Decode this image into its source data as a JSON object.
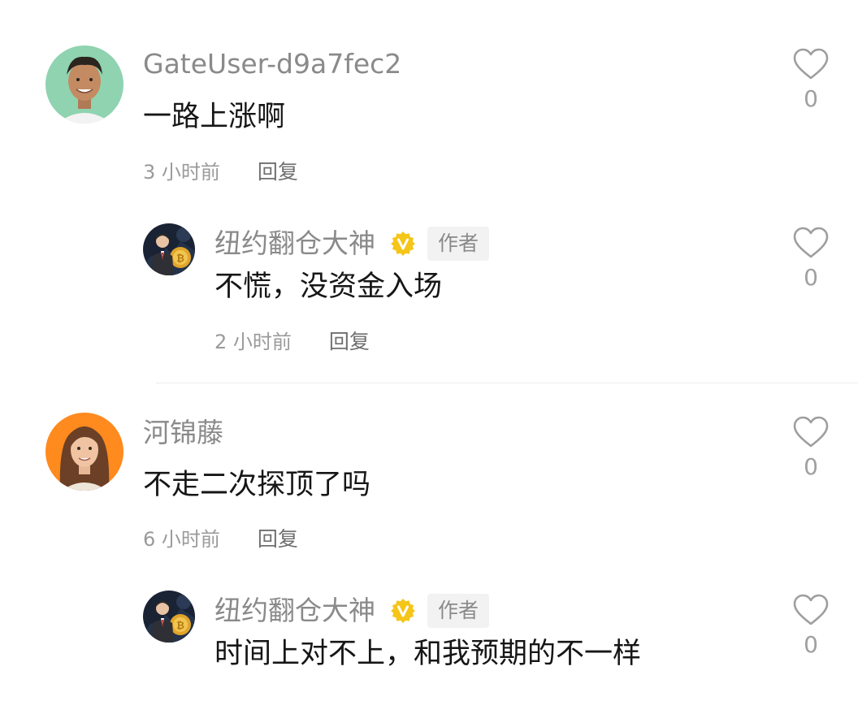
{
  "comments": [
    {
      "username": "GateUser-d9a7fec2",
      "text": "一路上涨啊",
      "time": "3 小时前",
      "reply_label": "回复",
      "likes": "0",
      "avatar_icon": "person-photo-avatar",
      "reply": {
        "username": "纽约翻仓大神",
        "author_tag": "作者",
        "text": "不慌，没资金入场",
        "time": "2 小时前",
        "reply_label": "回复",
        "likes": "0",
        "badge_color": "#f5c518"
      }
    },
    {
      "username": "河锦藤",
      "text": "不走二次探顶了吗",
      "time": "6 小时前",
      "reply_label": "回复",
      "likes": "0",
      "avatar_icon": "person-photo-avatar",
      "reply": {
        "username": "纽约翻仓大神",
        "author_tag": "作者",
        "text": "时间上对不上，和我预期的不一样",
        "time": "",
        "reply_label": "",
        "likes": "0",
        "badge_color": "#f5c518"
      }
    }
  ]
}
